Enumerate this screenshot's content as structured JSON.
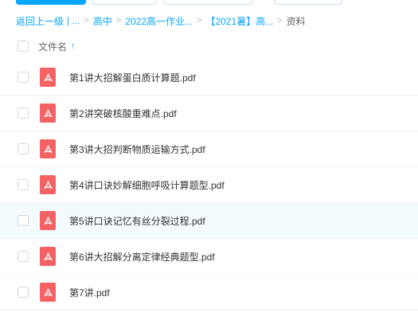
{
  "breadcrumb": {
    "back": "返回上一级",
    "ellipsis": "| ...",
    "items": [
      "高中",
      "2022高一作业...",
      "【2021暑】高..."
    ],
    "current": "资料",
    "separator": ">"
  },
  "list_header": {
    "column_name": "文件名",
    "sort_icon": "↑"
  },
  "files": [
    {
      "name": "第1讲大招解蛋白质计算题.pdf",
      "type": "pdf-icon"
    },
    {
      "name": "第2讲突破核酸重难点.pdf",
      "type": "pdf-icon"
    },
    {
      "name": "第3讲大招判断物质运输方式.pdf",
      "type": "pdf-icon"
    },
    {
      "name": "第4讲口诀妙解细胞呼吸计算题型.pdf",
      "type": "pdf-icon"
    },
    {
      "name": "第5讲口诀记忆有丝分裂过程.pdf",
      "type": "pdf-icon"
    },
    {
      "name": "第6讲大招解分离定律经典题型.pdf",
      "type": "pdf-icon"
    },
    {
      "name": "第7讲.pdf",
      "type": "pdf-icon"
    }
  ],
  "colors": {
    "accent": "#06a7ff",
    "pdf": "#f56264",
    "hover_row": "#f4fbff"
  }
}
